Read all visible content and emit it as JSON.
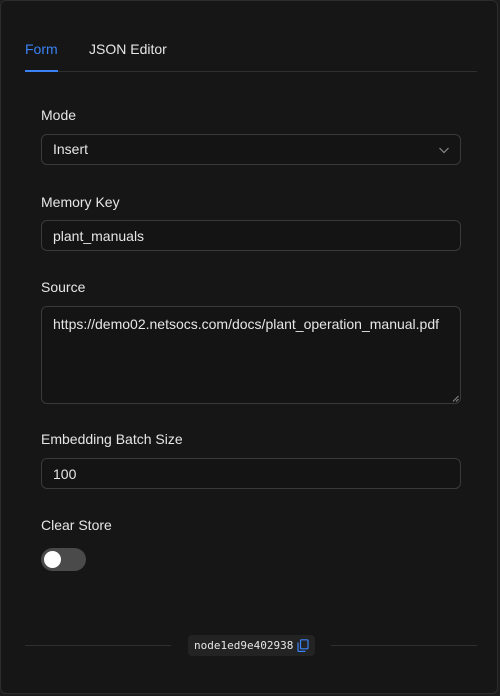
{
  "tabs": [
    {
      "label": "Form",
      "active": true
    },
    {
      "label": "JSON Editor",
      "active": false
    }
  ],
  "form": {
    "mode": {
      "label": "Mode",
      "value": "Insert"
    },
    "memory_key": {
      "label": "Memory Key",
      "value": "plant_manuals"
    },
    "source": {
      "label": "Source",
      "value": "https://demo02.netsocs.com/docs/plant_operation_manual.pdf"
    },
    "batch_size": {
      "label": "Embedding Batch Size",
      "value": "100"
    },
    "clear_store": {
      "label": "Clear Store",
      "enabled": false
    }
  },
  "footer": {
    "node_id": "node1ed9e402938",
    "copy_icon": "copy-icon"
  },
  "colors": {
    "accent": "#3b82f6",
    "background": "#161616",
    "border": "#3a3a3a"
  }
}
